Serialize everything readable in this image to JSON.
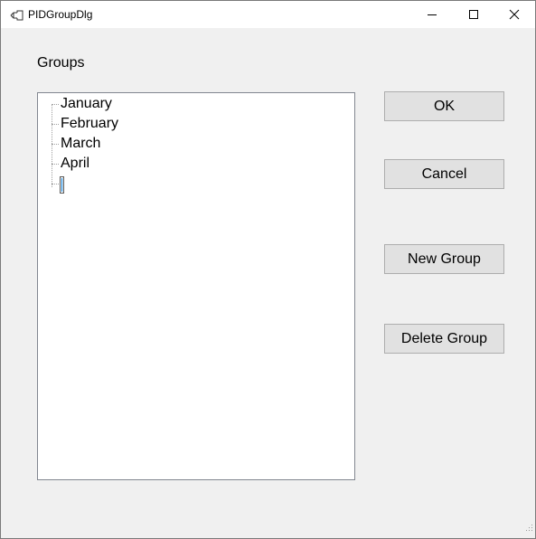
{
  "window": {
    "title": "PIDGroupDlg"
  },
  "groups_label": "Groups",
  "tree": {
    "items": [
      "January",
      "February",
      "March",
      "April"
    ],
    "editing_item": ""
  },
  "buttons": {
    "ok": "OK",
    "cancel": "Cancel",
    "new_group": "New Group",
    "delete_group": "Delete Group"
  },
  "icons": {
    "app": "dialog-app-icon",
    "minimize": "minimize-icon",
    "maximize": "maximize-icon",
    "close": "close-icon",
    "grip": "resize-grip-icon"
  }
}
